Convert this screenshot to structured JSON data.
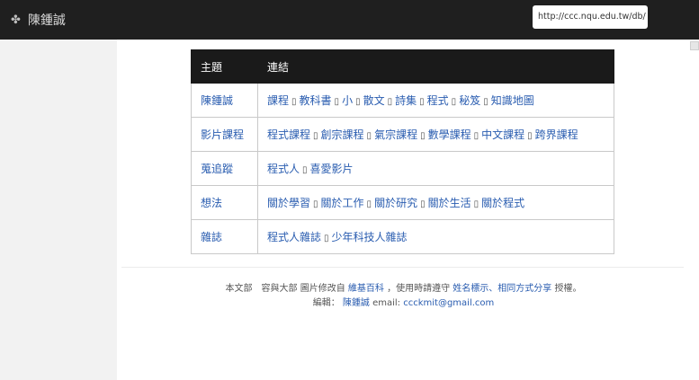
{
  "header": {
    "icon": "flower-icon",
    "title": "陳鍾誠",
    "url": "http://ccc.nqu.edu.tw/db/"
  },
  "table": {
    "headers": [
      "主題",
      "連結"
    ],
    "rows": [
      {
        "topic": "陳鍾誠",
        "links": [
          "課程",
          "教科書",
          "小",
          "散文",
          "詩集",
          "程式",
          "秘笈",
          "知識地圖"
        ]
      },
      {
        "topic": "影片課程",
        "links": [
          "程式課程",
          "創宗課程",
          "氣宗課程",
          "數學課程",
          "中文課程",
          "跨界課程"
        ]
      },
      {
        "topic": "蒐追蹤",
        "links": [
          "程式人",
          "喜愛影片"
        ]
      },
      {
        "topic": "想法",
        "links": [
          "關於學習",
          "關於工作",
          "關於研究",
          "關於生活",
          "關於程式"
        ]
      },
      {
        "topic": "雜誌",
        "links": [
          "程式人雜誌",
          "少年科技人雜誌"
        ]
      }
    ],
    "separator": "▯"
  },
  "footer": {
    "line1_prefix": "本文部　容與大部 圖片修改自",
    "line1_link1": "維基百科",
    "line1_mid": "，使用時請遵守",
    "line1_link2": "姓名標示、相同方式分享",
    "line1_suffix": "授權。",
    "line2_prefix": "編輯：",
    "line2_link": "陳鍾誠",
    "line2_email_label": "email:",
    "line2_email": "ccckmit@gmail.com"
  }
}
